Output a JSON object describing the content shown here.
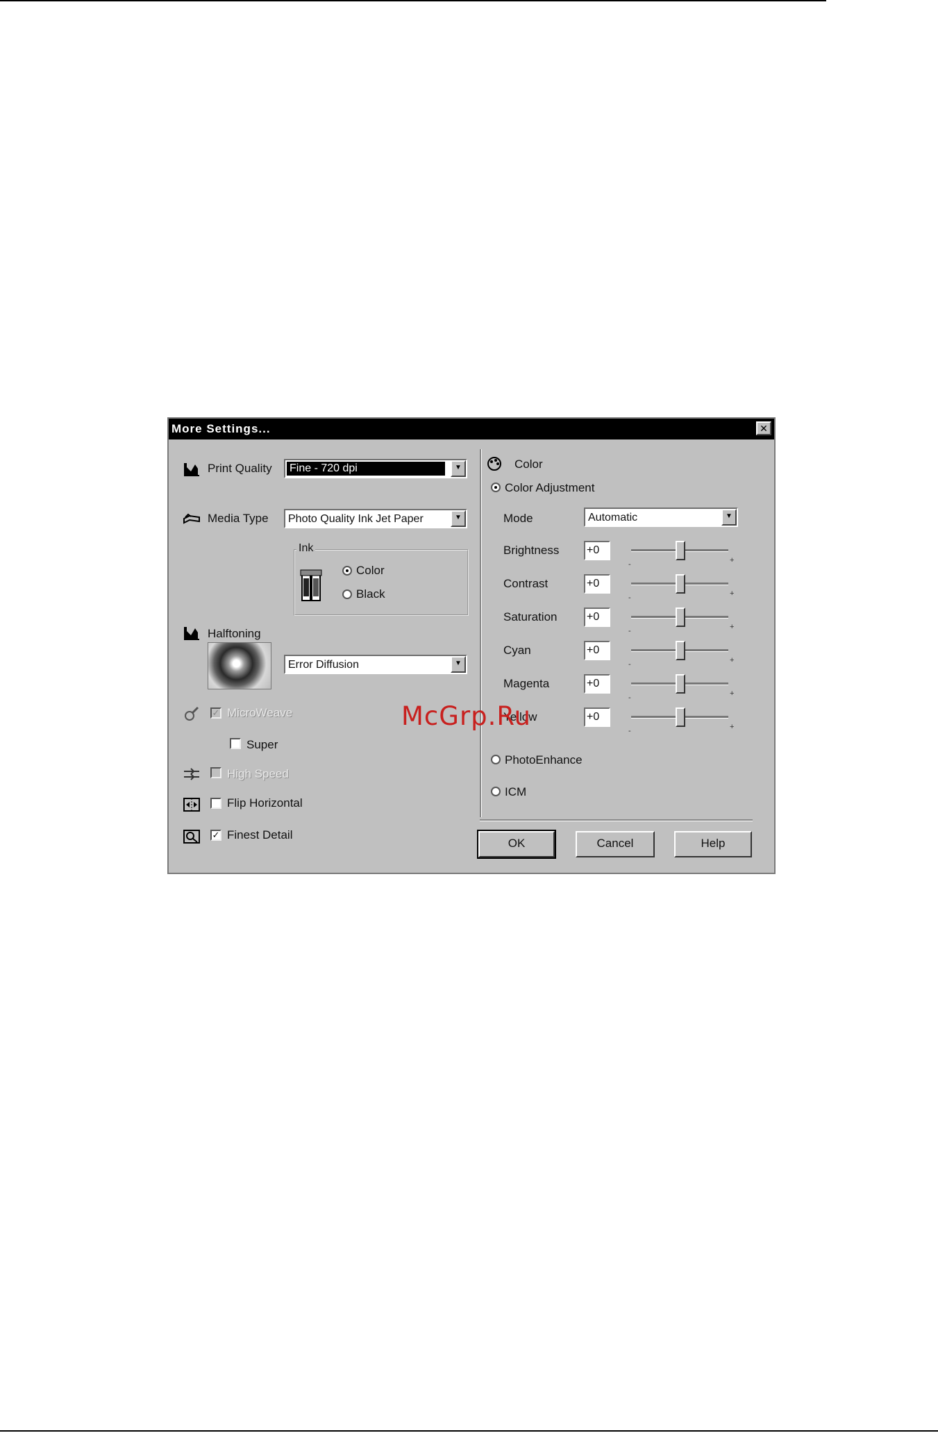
{
  "dialog": {
    "title": "More Settings...",
    "close_symbol": "✕"
  },
  "left": {
    "print_quality": {
      "label": "Print Quality",
      "value": "Fine - 720 dpi",
      "icon": "print-quality-icon"
    },
    "media_type": {
      "label": "Media Type",
      "value": "Photo Quality Ink Jet Paper",
      "icon": "media-type-icon"
    },
    "ink": {
      "title": "Ink",
      "color_label": "Color",
      "black_label": "Black",
      "selected": "Color",
      "icon": "ink-cartridge-icon"
    },
    "halftoning": {
      "label": "Halftoning",
      "value": "Error Diffusion",
      "icon": "halftoning-icon"
    },
    "microweave": {
      "label": "MicroWeave",
      "checked": true,
      "disabled": true
    },
    "super": {
      "label": "Super",
      "checked": false
    },
    "high_speed": {
      "label": "High Speed",
      "checked": false,
      "disabled": true
    },
    "flip_horizontal": {
      "label": "Flip Horizontal",
      "checked": false
    },
    "finest_detail": {
      "label": "Finest Detail",
      "checked": true
    },
    "check_mark": "✓"
  },
  "right": {
    "color_title": "Color",
    "color_adjustment_label": "Color Adjustment",
    "mode_label": "Mode",
    "mode_value": "Automatic",
    "sliders": [
      {
        "label": "Brightness",
        "value": "+0"
      },
      {
        "label": "Contrast",
        "value": "+0"
      },
      {
        "label": "Saturation",
        "value": "+0"
      },
      {
        "label": "Cyan",
        "value": "+0"
      },
      {
        "label": "Magenta",
        "value": "+0"
      },
      {
        "label": "Yellow",
        "value": "+0"
      }
    ],
    "tick_minus": "-",
    "tick_plus": "+",
    "photoenhance_label": "PhotoEnhance",
    "icm_label": "ICM",
    "selected": "Color Adjustment"
  },
  "buttons": {
    "ok": "OK",
    "cancel": "Cancel",
    "help": "Help"
  },
  "watermark": "McGrp.Ru",
  "colors": {
    "titlebar": "#000000",
    "dialog": "#c0c0c0",
    "watermark": "#c8201e"
  }
}
